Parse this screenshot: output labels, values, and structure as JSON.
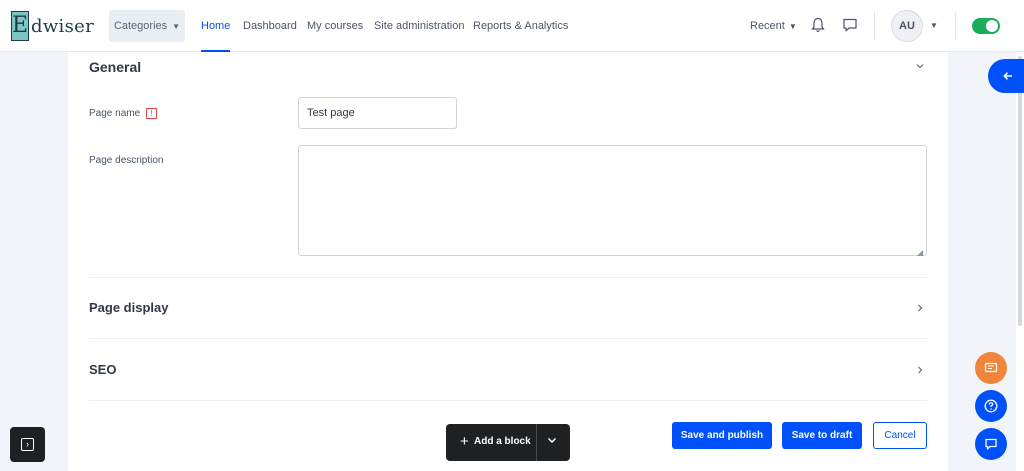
{
  "brand": {
    "logo_letter": "E",
    "logo_rest": "dwiser"
  },
  "nav": {
    "categories_label": "Categories",
    "links": [
      "Home",
      "Dashboard",
      "My courses",
      "Site administration",
      "Reports & Analytics"
    ],
    "active_index": 0,
    "recent_label": "Recent",
    "avatar_initials": "AU"
  },
  "form": {
    "general": {
      "title": "General",
      "page_name_label": "Page name",
      "required_mark": "!",
      "page_name_value": "Test page",
      "page_description_label": "Page description",
      "page_description_value": ""
    },
    "page_display_title": "Page display",
    "seo_title": "SEO",
    "buttons": {
      "save_publish": "Save and publish",
      "save_draft": "Save to draft",
      "cancel": "Cancel"
    }
  },
  "block_bar": {
    "add_label": "Add a block"
  },
  "colors": {
    "primary": "#0051f9",
    "toggle_on": "#1cac5a",
    "dark_button": "#1f2022",
    "orange_fab": "#f0853c"
  },
  "icons": [
    "bell-icon",
    "chat-icon",
    "chevron-down-icon",
    "chevron-right-icon",
    "arrow-left-icon",
    "help-icon",
    "feedback-icon",
    "message-icon",
    "plus-icon",
    "resize-grip-icon"
  ]
}
